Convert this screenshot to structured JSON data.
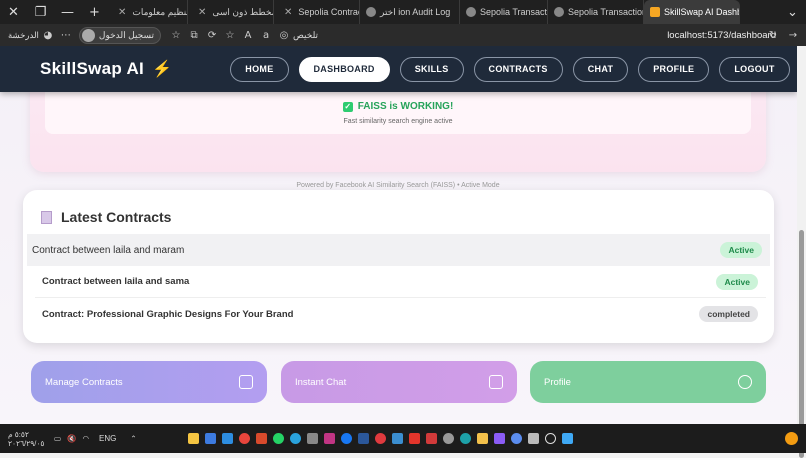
{
  "browser": {
    "tabs": [
      {
        "label": "ادارة تنظيم معلومات"
      },
      {
        "label": "مخطط ذون اسی_"
      },
      {
        "label": "Sepolia Contract In"
      },
      {
        "label": "اختر ion Audit Log"
      },
      {
        "label": "Sepolia Transaction"
      },
      {
        "label": "Sepolia Transaction"
      },
      {
        "label": "SkillSwap AI Dashb"
      }
    ],
    "profile_label": "تسجيل الدخول",
    "rank_label": "الدرخشة",
    "summarize_label": "تلخيص",
    "url": "localhost:5173/dashboard"
  },
  "app": {
    "brand": "SkillSwap AI",
    "nav": [
      "HOME",
      "DASHBOARD",
      "SKILLS",
      "CONTRACTS",
      "CHAT",
      "PROFILE",
      "LOGOUT"
    ],
    "active_nav": "DASHBOARD"
  },
  "faiss": {
    "status": "FAISS is WORKING!",
    "subtitle": "Fast similarity search engine active",
    "footer": "Powered by Facebook AI Similarity Search (FAISS) • Active Mode"
  },
  "contracts": {
    "title": "Latest Contracts",
    "rows": [
      {
        "name": "Contract between laila and maram",
        "status": "Active"
      },
      {
        "name": "Contract between laila and sama",
        "status": "Active"
      },
      {
        "name": "Contract: Professional Graphic Designs For Your Brand",
        "status": "completed"
      }
    ]
  },
  "actions": [
    {
      "label": "Manage Contracts",
      "icon": "edit-icon"
    },
    {
      "label": "Instant Chat",
      "icon": "chat-icon"
    },
    {
      "label": "Profile",
      "icon": "user-check-icon"
    }
  ],
  "taskbar": {
    "time": "٥:٥٢ م",
    "date": "٢٠٢٦/٢٩/٠٥",
    "lang": "ENG"
  }
}
